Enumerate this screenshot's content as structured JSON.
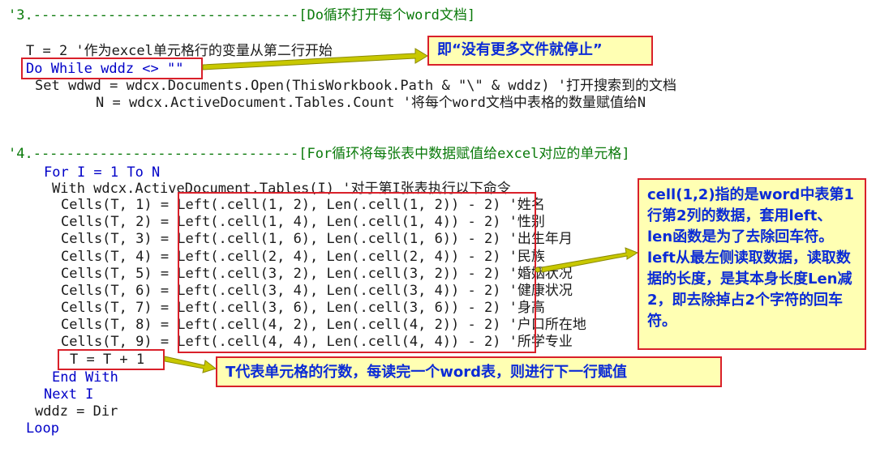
{
  "code_lines": [
    "'3.--------------------------------[Do循环打开每个word文档]",
    "T = 2 '作为excel单元格行的变量从第二行开始",
    "Do While wddz <> \"\"",
    "Set wdwd = wdcx.Documents.Open(ThisWorkbook.Path & \"\\\" & wddz) '打开搜索到的文档",
    "N = wdcx.ActiveDocument.Tables.Count '将每个word文档中表格的数量赋值给N",
    "'4.--------------------------------[For循环将每张表中数据赋值给excel对应的单元格]",
    "For I = 1 To N",
    "With wdcx.ActiveDocument.Tables(I) '对于第I张表执行以下命令",
    "Cells(T, 1) = Left(.cell(1, 2), Len(.cell(1, 2)) - 2) '姓名",
    "Cells(T, 2) = Left(.cell(1, 4), Len(.cell(1, 4)) - 2) '性别",
    "Cells(T, 3) = Left(.cell(1, 6), Len(.cell(1, 6)) - 2) '出生年月",
    "Cells(T, 4) = Left(.cell(2, 4), Len(.cell(2, 4)) - 2) '民族",
    "Cells(T, 5) = Left(.cell(3, 2), Len(.cell(3, 2)) - 2) '婚姻状况",
    "Cells(T, 6) = Left(.cell(3, 4), Len(.cell(3, 4)) - 2) '健康状况",
    "Cells(T, 7) = Left(.cell(3, 6), Len(.cell(3, 6)) - 2) '身高",
    "Cells(T, 8) = Left(.cell(4, 2), Len(.cell(4, 2)) - 2) '户口所在地",
    "Cells(T, 9) = Left(.cell(4, 4), Len(.cell(4, 4)) - 2) '所学专业",
    "T = T + 1",
    "End With",
    "Next I",
    "wddz = Dir",
    "Loop"
  ],
  "callouts": {
    "do_while_note": "即“没有更多文件就停止”",
    "cell_note": "cell(1,2)指的是word中表第1行第2列的数据，套用left、len函数是为了去除回车符。left从最左侧读取数据，读取数据的长度，是其本身长度Len减2，即去除掉占2个字符的回车符。",
    "t_note": "T代表单元格的行数，每读完一个word表，则进行下一行赋值"
  },
  "colors": {
    "comment": "#0a7a0a",
    "keyword": "#0000c8",
    "annotation_border": "#d9202a",
    "callout_bg": "#ffffb3",
    "callout_text": "#0b2bd6",
    "arrow": "#c8c800"
  }
}
